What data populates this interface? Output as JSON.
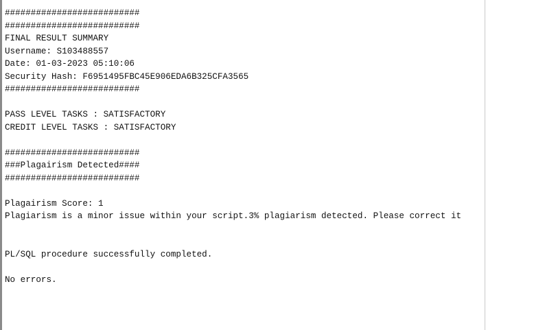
{
  "output": {
    "lines": [
      "##########################",
      "##########################",
      "FINAL RESULT SUMMARY",
      "Username: S103488557",
      "Date: 01-03-2023 05:10:06",
      "Security Hash: F6951495FBC45E906EDA6B325CFA3565",
      "##########################",
      "",
      "PASS LEVEL TASKS : SATISFACTORY",
      "CREDIT LEVEL TASKS : SATISFACTORY",
      "",
      "##########################",
      "###Plagairism Detected####",
      "##########################",
      "",
      "Plagairism Score: 1",
      "Plagiarism is a minor issue within your script.3% plagiarism detected. Please correct it",
      "",
      "",
      "PL/SQL procedure successfully completed.",
      "",
      "No errors.",
      ""
    ]
  }
}
